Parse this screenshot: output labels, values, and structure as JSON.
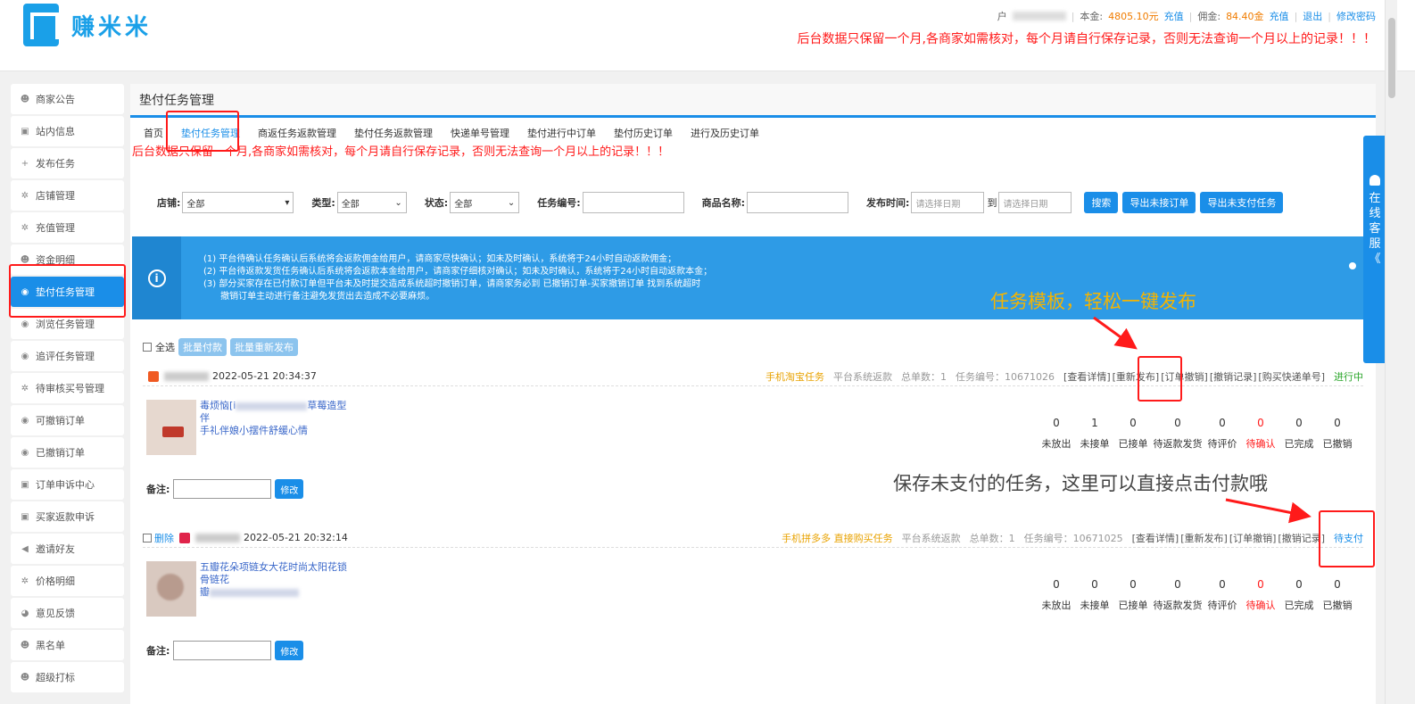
{
  "header": {
    "logo_text": "赚米米",
    "user_prefix": "户",
    "balance_label": "本金:",
    "balance_value": "4805.10元",
    "recharge_label": "充值",
    "commission_label": "佣金:",
    "commission_value": "84.40金",
    "recharge2_label": "充值",
    "logout_label": "退出",
    "change_pwd_label": "修改密码",
    "warning": "后台数据只保留一个月,各商家如需核对，每个月请自行保存记录，否则无法查询一个月以上的记录！！！"
  },
  "sidebar": {
    "items": [
      {
        "label": "商家公告",
        "icon": "smile-icon"
      },
      {
        "label": "站内信息",
        "icon": "message-icon"
      },
      {
        "label": "发布任务",
        "icon": "plus-icon"
      },
      {
        "label": "店铺管理",
        "icon": "gear-icon"
      },
      {
        "label": "充值管理",
        "icon": "gear-icon"
      },
      {
        "label": "资金明细",
        "icon": "smile-icon"
      },
      {
        "label": "垫付任务管理",
        "icon": "eye-icon"
      },
      {
        "label": "浏览任务管理",
        "icon": "eye-icon"
      },
      {
        "label": "追评任务管理",
        "icon": "eye-icon"
      },
      {
        "label": "待审核买号管理",
        "icon": "gear-icon"
      },
      {
        "label": "可撤销订单",
        "icon": "eye-icon"
      },
      {
        "label": "已撤销订单",
        "icon": "eye-icon"
      },
      {
        "label": "订单申诉中心",
        "icon": "message-icon"
      },
      {
        "label": "买家返款申诉",
        "icon": "message-icon"
      },
      {
        "label": "邀请好友",
        "icon": "share-icon"
      },
      {
        "label": "价格明细",
        "icon": "gear-icon"
      },
      {
        "label": "意见反馈",
        "icon": "feedback-icon"
      },
      {
        "label": "黑名单",
        "icon": "smile-icon"
      },
      {
        "label": "超级打标",
        "icon": "smile-icon"
      }
    ]
  },
  "main": {
    "title": "垫付任务管理",
    "tabs": [
      "首页",
      "垫付任务管理",
      "商返任务返款管理",
      "垫付任务返款管理",
      "快递单号管理",
      "垫付进行中订单",
      "垫付历史订单",
      "进行及历史订单"
    ],
    "warning": "后台数据只保留一个月,各商家如需核对，每个月请自行保存记录，否则无法查询一个月以上的记录！！！"
  },
  "filters": {
    "shop_label": "店铺:",
    "shop_value": "全部",
    "type_label": "类型:",
    "type_value": "全部",
    "status_label": "状态:",
    "status_value": "全部",
    "task_no_label": "任务编号:",
    "goods_label": "商品名称:",
    "time_label": "发布时间:",
    "date_placeholder": "请选择日期",
    "to_label": "到",
    "search_btn": "搜索",
    "export1_btn": "导出未接订单",
    "export2_btn": "导出未支付任务"
  },
  "notice": {
    "lines": [
      "(1)  平台待确认任务确认后系统将会返款佣金给用户，请商家尽快确认；如未及时确认，系统将于24小时自动返款佣金；",
      "(2)  平台待返款发货任务确认后系统将会返款本金给用户，请商家仔细核对确认；如未及时确认，系统将于24小时自动返款本金；",
      "(3)  部分买家存在已付款订单但平台未及时提交造成系统超时撤销订单，请商家务必到 已撤销订单-买家撤销订单 找到系统超时",
      "      撤销订单主动进行备注避免发货出去造成不必要麻烦。"
    ]
  },
  "annotations": {
    "a1": "任务模板，轻松一键发布",
    "a2": "保存未支付的任务，这里可以直接点击付款哦"
  },
  "bulk": {
    "select_all": "全选",
    "batch_pay": "批量付款",
    "batch_republish": "批量重新发布"
  },
  "orders": [
    {
      "shop": "旗舰店",
      "time": "2022-05-21 20:34:37",
      "task_type": "手机淘宝任务",
      "refund": "平台系统返款",
      "total": "总单数：1",
      "task_no": "任务编号：10671026",
      "actions": [
        "[查看详情]",
        "[重新发布]",
        "[订单撤销]",
        "[撤销记录]",
        "[购买快递单号]"
      ],
      "status": "进行中",
      "goods_line1": "毒烦恼[i",
      "goods_line1b": "草莓造型伴",
      "goods_line2": "手礼伴娘小摆件舒缓心情",
      "stats": [
        "0",
        "1",
        "0",
        "0",
        "0",
        "0",
        "0",
        "0"
      ]
    },
    {
      "delete": "删除",
      "shop": "旗舰店",
      "time": "2022-05-21 20:32:14",
      "task_type": "手机拼多多 直接购买任务",
      "refund": "平台系统返款",
      "total": "总单数：1",
      "task_no": "任务编号：10671025",
      "actions": [
        "[查看详情]",
        "[重新发布]",
        "[订单撤销]",
        "[撤销记录]"
      ],
      "status": "待支付",
      "goods_line1": "五瓣花朵项链女大花时尚太阳花锁骨链花",
      "goods_line2": "瓣",
      "stats": [
        "0",
        "0",
        "0",
        "0",
        "0",
        "0",
        "0",
        "0"
      ]
    }
  ],
  "stat_labels": [
    "未放出",
    "未接单",
    "已接单",
    "待返款发货",
    "待评价",
    "待确认",
    "已完成",
    "已撤销"
  ],
  "remark_label": "备注:",
  "modify_btn": "修改",
  "float_service": [
    "在",
    "线",
    "客",
    "服",
    "《"
  ],
  "colors": {
    "primary": "#1a8ee8",
    "warning_red": "#ff1a1a",
    "annotation_yellow": "#f5b400"
  }
}
